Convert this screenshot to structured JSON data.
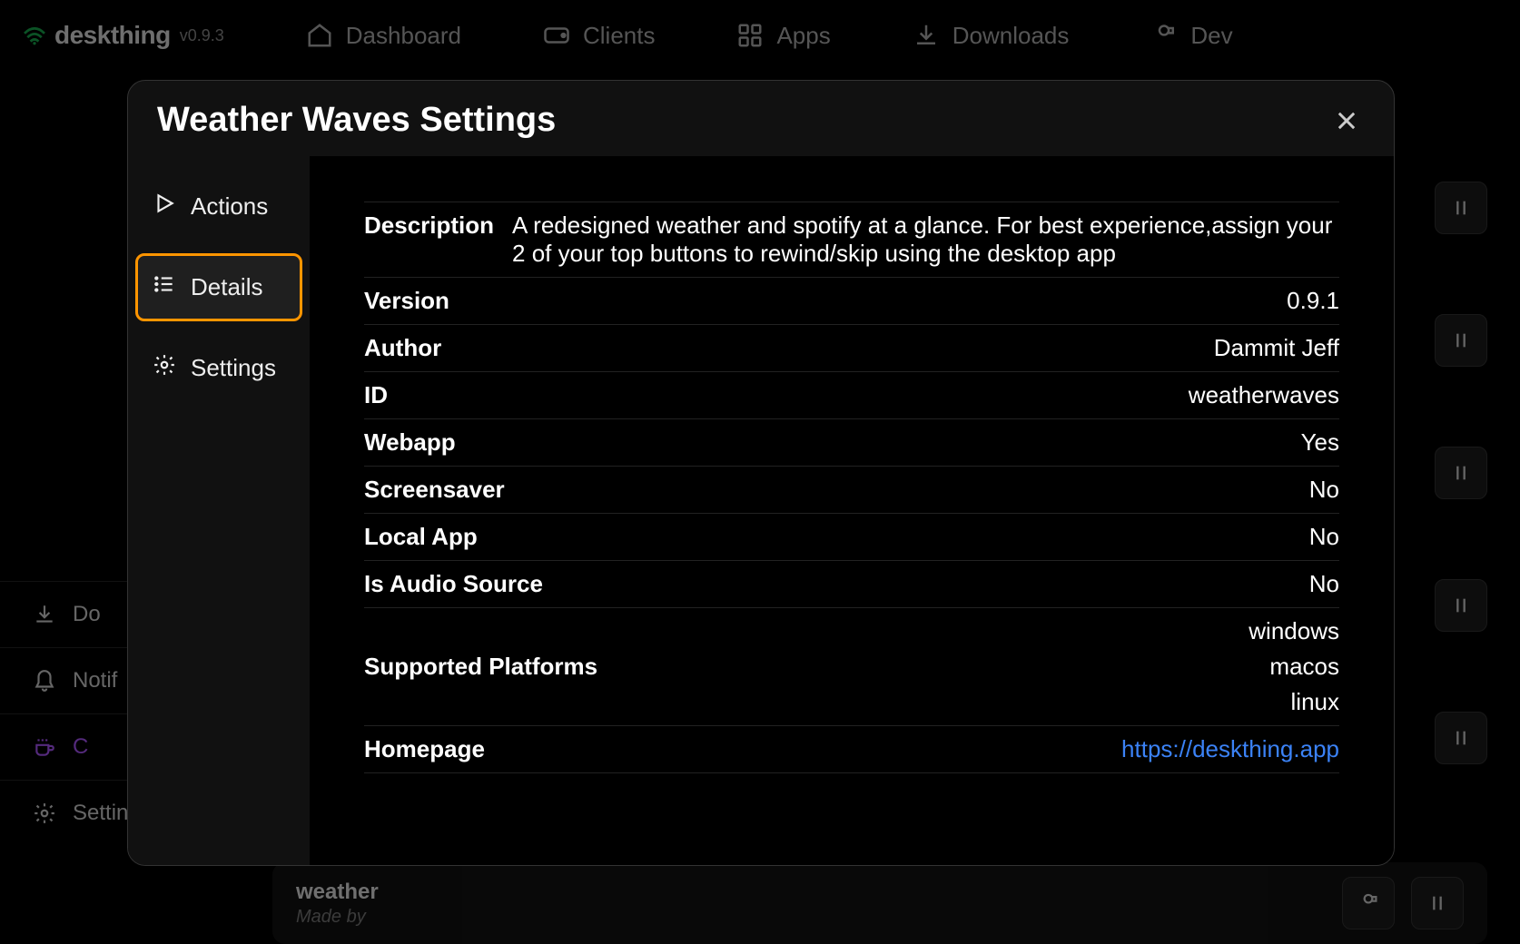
{
  "brand": {
    "name": "deskthing",
    "version": "v0.9.3"
  },
  "nav": {
    "dashboard": "Dashboard",
    "clients": "Clients",
    "apps": "Apps",
    "downloads": "Downloads",
    "dev": "Dev"
  },
  "left_sidebar": {
    "downloads": "Do",
    "notifications": "Notif",
    "coffee": "C",
    "settings": "Settings"
  },
  "modal": {
    "title": "Weather Waves Settings",
    "tabs": {
      "actions": "Actions",
      "details": "Details",
      "settings": "Settings"
    },
    "details": {
      "description_label": "Description",
      "description_value": "A redesigned weather and spotify at a glance. For best experience,assign your 2 of your top buttons to rewind/skip using the desktop app",
      "version_label": "Version",
      "version_value": "0.9.1",
      "author_label": "Author",
      "author_value": "Dammit Jeff",
      "id_label": "ID",
      "id_value": "weatherwaves",
      "webapp_label": "Webapp",
      "webapp_value": "Yes",
      "screensaver_label": "Screensaver",
      "screensaver_value": "No",
      "localapp_label": "Local App",
      "localapp_value": "No",
      "audiosource_label": "Is Audio Source",
      "audiosource_value": "No",
      "platforms_label": "Supported Platforms",
      "platforms": {
        "p0": "windows",
        "p1": "macos",
        "p2": "linux"
      },
      "homepage_label": "Homepage",
      "homepage_value": "https://deskthing.app"
    }
  },
  "bottom_card": {
    "title": "weather",
    "subtitle": "Made by"
  }
}
